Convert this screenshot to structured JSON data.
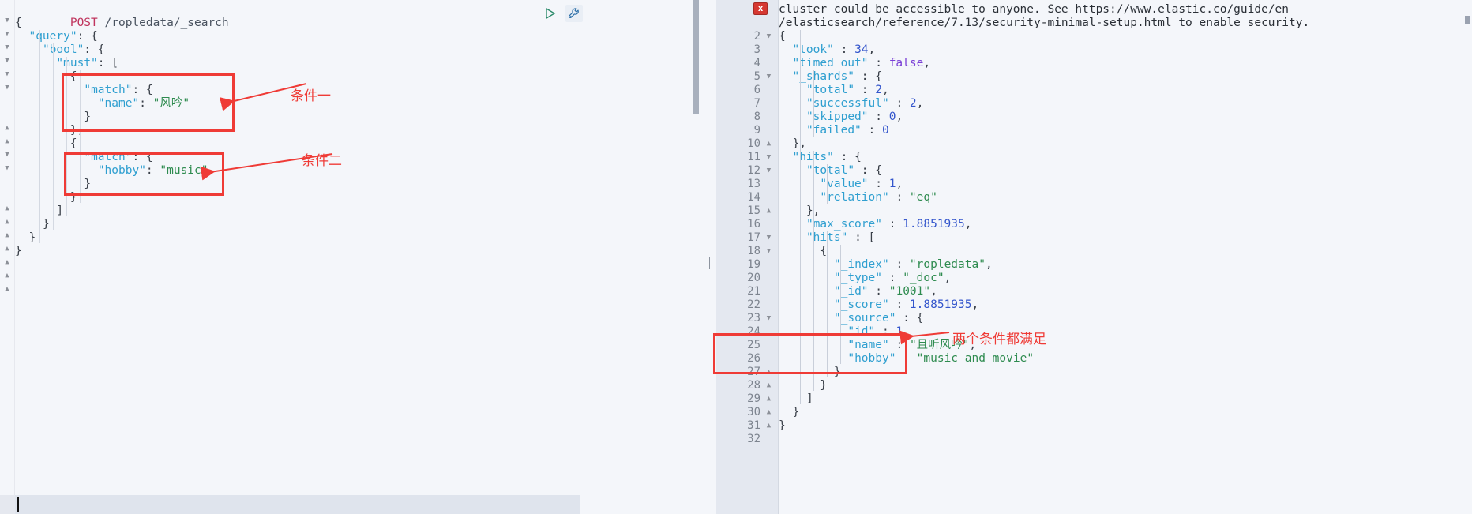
{
  "request": {
    "method": "POST",
    "path": "/ropledata/_search",
    "lines": [
      "{",
      "  \"query\": {",
      "    \"bool\": {",
      "      \"must\": [",
      "        {",
      "          \"match\": {",
      "            \"name\": \"风吟\"",
      "          }",
      "        },",
      "        {",
      "          \"match\": {",
      "            \"hobby\": \"music\"",
      "          }",
      "        }",
      "      ]",
      "    }",
      "  }",
      "}"
    ]
  },
  "toolbar": {
    "run_label": "send-request",
    "wrench_label": "request-options"
  },
  "response": {
    "warning_line_1": "cluster could be accessible to anyone. See https://www.elastic.co/guide/en",
    "warning_line_2": "/elasticsearch/reference/7.13/security-minimal-setup.html to enable security.",
    "error_marker": "x",
    "lines": [
      {
        "num": "2",
        "fold": "down",
        "text": "{"
      },
      {
        "num": "3",
        "fold": "",
        "text": "  \"took\" : 34,"
      },
      {
        "num": "4",
        "fold": "",
        "text": "  \"timed_out\" : false,"
      },
      {
        "num": "5",
        "fold": "down",
        "text": "  \"_shards\" : {"
      },
      {
        "num": "6",
        "fold": "",
        "text": "    \"total\" : 2,"
      },
      {
        "num": "7",
        "fold": "",
        "text": "    \"successful\" : 2,"
      },
      {
        "num": "8",
        "fold": "",
        "text": "    \"skipped\" : 0,"
      },
      {
        "num": "9",
        "fold": "",
        "text": "    \"failed\" : 0"
      },
      {
        "num": "10",
        "fold": "up",
        "text": "  },"
      },
      {
        "num": "11",
        "fold": "down",
        "text": "  \"hits\" : {"
      },
      {
        "num": "12",
        "fold": "down",
        "text": "    \"total\" : {"
      },
      {
        "num": "13",
        "fold": "",
        "text": "      \"value\" : 1,"
      },
      {
        "num": "14",
        "fold": "",
        "text": "      \"relation\" : \"eq\""
      },
      {
        "num": "15",
        "fold": "up",
        "text": "    },"
      },
      {
        "num": "16",
        "fold": "",
        "text": "    \"max_score\" : 1.8851935,"
      },
      {
        "num": "17",
        "fold": "down",
        "text": "    \"hits\" : ["
      },
      {
        "num": "18",
        "fold": "down",
        "text": "      {"
      },
      {
        "num": "19",
        "fold": "",
        "text": "        \"_index\" : \"ropledata\","
      },
      {
        "num": "20",
        "fold": "",
        "text": "        \"_type\" : \"_doc\","
      },
      {
        "num": "21",
        "fold": "",
        "text": "        \"_id\" : \"1001\","
      },
      {
        "num": "22",
        "fold": "",
        "text": "        \"_score\" : 1.8851935,"
      },
      {
        "num": "23",
        "fold": "down",
        "text": "        \"_source\" : {"
      },
      {
        "num": "24",
        "fold": "",
        "text": "          \"id\" : 1,"
      },
      {
        "num": "25",
        "fold": "",
        "text": "          \"name\" : \"且听风吟\","
      },
      {
        "num": "26",
        "fold": "",
        "text": "          \"hobby\" : \"music and movie\""
      },
      {
        "num": "27",
        "fold": "up",
        "text": "        }"
      },
      {
        "num": "28",
        "fold": "up",
        "text": "      }"
      },
      {
        "num": "29",
        "fold": "up",
        "text": "    ]"
      },
      {
        "num": "30",
        "fold": "up",
        "text": "  }"
      },
      {
        "num": "31",
        "fold": "up",
        "text": "}"
      },
      {
        "num": "32",
        "fold": "",
        "text": ""
      }
    ]
  },
  "annotations": {
    "condition_one": "条件一",
    "condition_two": "条件二",
    "both_conditions": "两个条件都满足"
  },
  "colors": {
    "annotation_red": "#ef3b36",
    "editor_background": "#f4f6fa",
    "gutter_background": "#e4e8f0",
    "string_green": "#2e8b4f",
    "key_blue": "#2f9fd0",
    "method_pink": "#c0355e"
  }
}
